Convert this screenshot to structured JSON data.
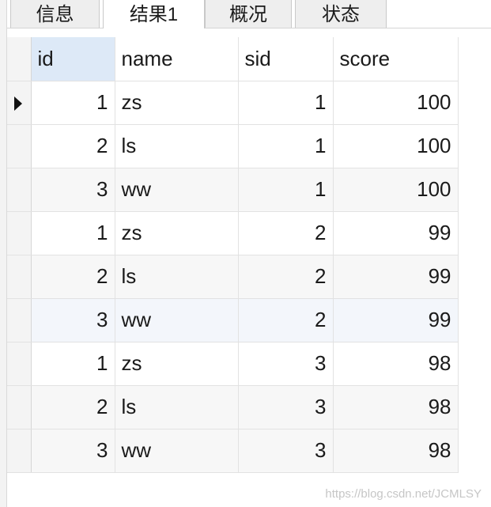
{
  "tabs": [
    {
      "label": "信息",
      "active": false
    },
    {
      "label": "结果1",
      "active": true
    },
    {
      "label": "概况",
      "active": false
    },
    {
      "label": "状态",
      "active": false
    }
  ],
  "columns": [
    "id",
    "name",
    "sid",
    "score"
  ],
  "rows": [
    [
      "1",
      "zs",
      "1",
      "100"
    ],
    [
      "2",
      "ls",
      "1",
      "100"
    ],
    [
      "3",
      "ww",
      "1",
      "100"
    ],
    [
      "1",
      "zs",
      "2",
      "99"
    ],
    [
      "2",
      "ls",
      "2",
      "99"
    ],
    [
      "3",
      "ww",
      "2",
      "99"
    ],
    [
      "1",
      "zs",
      "3",
      "98"
    ],
    [
      "2",
      "ls",
      "3",
      "98"
    ],
    [
      "3",
      "ww",
      "3",
      "98"
    ]
  ],
  "watermark": "https://blog.csdn.net/JCMLSY",
  "icons": {
    "current_row": "row-pointer-icon"
  }
}
